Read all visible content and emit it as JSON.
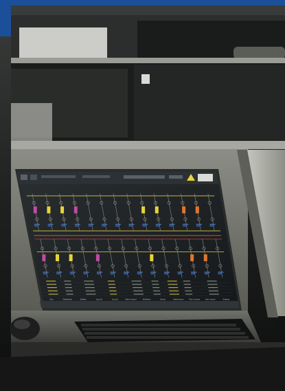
{
  "colors": {
    "brand_blue": "#1c4f9a",
    "console_gray": "#6c6d68",
    "console_dark": "#1a1b1a",
    "screen_bg": "#1e2224",
    "alarm_yellow": "#e8d43a",
    "alarm_orange": "#e0772e",
    "alarm_magenta": "#c04aa6",
    "line_yellow": "#c8b640",
    "line_orange": "#d06a2a",
    "line_red": "#b23a3a"
  },
  "icons": [
    "warning-icon",
    "brand-logo-icon"
  ],
  "footer_tabs": [
    {
      "label": "Grip"
    },
    {
      "label": "Dashboard"
    },
    {
      "label": "Sidebar"
    },
    {
      "label": "Log List"
    },
    {
      "label": "Log List"
    },
    {
      "label": "Alarm Control"
    },
    {
      "label": "All Alarms"
    },
    {
      "label": "Trends"
    },
    {
      "label": "Maintenance"
    },
    {
      "label": "Time Controls"
    },
    {
      "label": "User Control"
    },
    {
      "label": "Settings"
    }
  ]
}
